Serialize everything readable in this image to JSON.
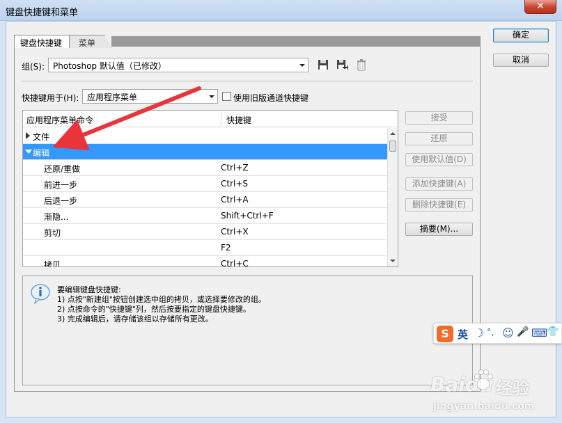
{
  "window": {
    "title": "键盘快捷键和菜单",
    "close_glyph": "✕"
  },
  "tabs": [
    {
      "label": "键盘快捷键"
    },
    {
      "label": "菜单"
    }
  ],
  "set": {
    "label": "组(S):",
    "value": "Photoshop 默认值（已修改）"
  },
  "shortcuts_for": {
    "label": "快捷键用于(H):",
    "value": "应用程序菜单"
  },
  "legacy_checkbox": {
    "label": "使用旧版通道快捷键",
    "checked": false
  },
  "table": {
    "columns": [
      "应用程序菜单命令",
      "快捷键"
    ],
    "rows": [
      {
        "command": "文件",
        "shortcut": "",
        "type": "group",
        "expanded": false
      },
      {
        "command": "编辑",
        "shortcut": "",
        "type": "group",
        "expanded": true,
        "selected": true
      },
      {
        "command": "还原/重做",
        "shortcut": "Ctrl+Z"
      },
      {
        "command": "前进一步",
        "shortcut": "Ctrl+S"
      },
      {
        "command": "后退一步",
        "shortcut": "Ctrl+A"
      },
      {
        "command": "渐隐...",
        "shortcut": "Shift+Ctrl+F"
      },
      {
        "command": "剪切",
        "shortcut": "Ctrl+X"
      },
      {
        "command": "",
        "shortcut": "F2"
      },
      {
        "command": "拷贝",
        "shortcut": "Ctrl+C"
      }
    ]
  },
  "side_buttons": {
    "accept": "接受",
    "undo": "还原",
    "use_default": "使用默认值(D)",
    "add_shortcut": "添加快捷键(A)",
    "delete_shortcut": "删除快捷键(E)",
    "summarize": "摘要(M)..."
  },
  "dialog_buttons": {
    "ok": "确定",
    "cancel": "取消"
  },
  "info": {
    "lines": [
      "要编辑键盘快捷键:",
      "1) 点按\"新建组\"按钮创建选中组的拷贝，或选择要修改的组。",
      "2) 点按命令的\"快捷键\"列，然后按要指定的键盘快捷键。",
      "3) 完成编辑后，请存储该组以存储所有更改。"
    ]
  },
  "ime_toolbar": {
    "logo": "S",
    "mode": "英",
    "symbols": [
      "☽",
      "°,",
      "☺",
      "🎤",
      "⌨",
      "👕"
    ]
  },
  "watermark": {
    "brand": "Baidu",
    "suffix": "经验",
    "url": "jingyan.baidu.com"
  },
  "colors": {
    "selection": "#3399ff",
    "annotation_arrow": "#e8343a",
    "ime_logo": "#f26b2a"
  }
}
